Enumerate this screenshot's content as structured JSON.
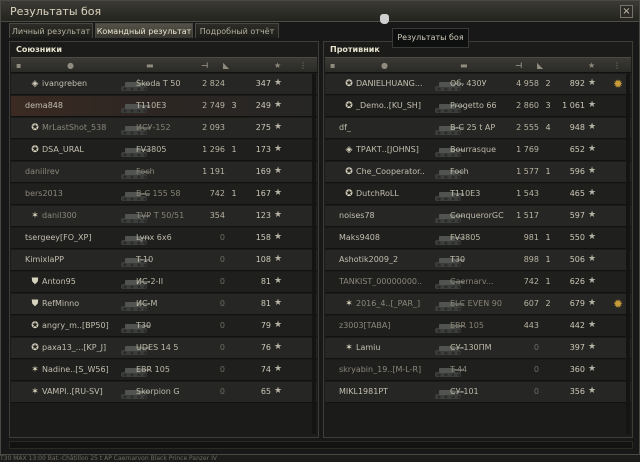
{
  "window": {
    "title": "Результаты боя",
    "close_label": "×"
  },
  "tabs": [
    {
      "label": "Личный результат",
      "active": false
    },
    {
      "label": "Командный результат",
      "active": true
    },
    {
      "label": "Подробный отчёт",
      "active": false
    }
  ],
  "tooltip": "Результаты боя",
  "allies": {
    "team_name": "Союзники",
    "rows": [
      {
        "clan_icon": "rank-icon",
        "player": "ivangreben",
        "tank": "Škoda T 50",
        "damage": "2 824",
        "kills": "",
        "xp": "347",
        "dead": false
      },
      {
        "clan_icon": "",
        "player": "dema848",
        "tank": "T110E3",
        "damage": "2 749",
        "kills": "3",
        "xp": "249",
        "dead": false,
        "self": true
      },
      {
        "clan_icon": "clan-emblem-icon",
        "player": "MrLastShot_538",
        "tank": "ИСУ-152",
        "damage": "2 093",
        "kills": "",
        "xp": "275",
        "dead": true
      },
      {
        "clan_icon": "clan-emblem-icon",
        "player": "DSA_URAL",
        "tank": "FV3805",
        "damage": "1 296",
        "kills": "1",
        "xp": "173",
        "dead": false
      },
      {
        "clan_icon": "",
        "player": "daniilrev",
        "tank": "Foch",
        "damage": "1 191",
        "kills": "",
        "xp": "169",
        "dead": true
      },
      {
        "clan_icon": "",
        "player": "bers2013",
        "tank": "B-C 155 58",
        "damage": "742",
        "kills": "1",
        "xp": "167",
        "dead": true
      },
      {
        "clan_icon": "star-badge-icon",
        "player": "danil300",
        "tank": "TVP T 50/51",
        "damage": "354",
        "kills": "",
        "xp": "123",
        "dead": true
      },
      {
        "clan_icon": "",
        "player": "tsergeey[FO_XP]",
        "tank": "Lynx 6x6",
        "damage": "0",
        "kills": "",
        "xp": "158",
        "dead": false
      },
      {
        "clan_icon": "",
        "player": "KimixlaPP",
        "tank": "T-10",
        "damage": "0",
        "kills": "",
        "xp": "108",
        "dead": false
      },
      {
        "clan_icon": "shield-rank-icon",
        "player": "Anton95",
        "tank": "ИС-2-II",
        "damage": "0",
        "kills": "",
        "xp": "81",
        "dead": false
      },
      {
        "clan_icon": "shield-rank-icon",
        "player": "RefMinno",
        "tank": "ИС-М",
        "damage": "0",
        "kills": "",
        "xp": "81",
        "dead": false
      },
      {
        "clan_icon": "clan-emblem-icon",
        "player": "angry_m..[BP50]",
        "tank": "T30",
        "damage": "0",
        "kills": "",
        "xp": "79",
        "dead": false
      },
      {
        "clan_icon": "clan-emblem-icon",
        "player": "paxa13_...[KP_J]",
        "tank": "UDES 14 5",
        "damage": "0",
        "kills": "",
        "xp": "76",
        "dead": false
      },
      {
        "clan_icon": "star-badge-icon",
        "player": "Nadine..[S_W56]",
        "tank": "EBR 105",
        "damage": "0",
        "kills": "",
        "xp": "74",
        "dead": false
      },
      {
        "clan_icon": "star-badge-icon",
        "player": "VAMPI..[RU-SV]",
        "tank": "Skorpion G",
        "damage": "0",
        "kills": "",
        "xp": "65",
        "dead": false
      }
    ]
  },
  "enemies": {
    "team_name": "Противник",
    "rows": [
      {
        "clan_icon": "clan-emblem-icon",
        "player": "DANIELHUANG...",
        "tank": "Об. 430У",
        "damage": "4 958",
        "kills": "2",
        "xp": "892",
        "dead": false,
        "medal": true
      },
      {
        "clan_icon": "clan-emblem-icon",
        "player": "_Demo..[KU_SH]",
        "tank": "Progetto 66",
        "damage": "2 860",
        "kills": "3",
        "xp": "1 061",
        "dead": false
      },
      {
        "clan_icon": "",
        "player": "df_",
        "tank": "B-C 25 t AP",
        "damage": "2 555",
        "kills": "4",
        "xp": "948",
        "dead": false
      },
      {
        "clan_icon": "rank-icon",
        "player": "ТРАКТ..[JOHNS]",
        "tank": "Bourrasque",
        "damage": "1 769",
        "kills": "",
        "xp": "652",
        "dead": false
      },
      {
        "clan_icon": "clan-emblem-icon",
        "player": "Che_Cooperator..",
        "tank": "Foch",
        "damage": "1 577",
        "kills": "1",
        "xp": "596",
        "dead": false
      },
      {
        "clan_icon": "clan-emblem-icon",
        "player": "DutchRoLL",
        "tank": "T110E3",
        "damage": "1 543",
        "kills": "",
        "xp": "465",
        "dead": false
      },
      {
        "clan_icon": "",
        "player": "noises78",
        "tank": "ConquerorGC",
        "damage": "1 517",
        "kills": "",
        "xp": "597",
        "dead": false
      },
      {
        "clan_icon": "",
        "player": "Maks9408",
        "tank": "FV3805",
        "damage": "981",
        "kills": "1",
        "xp": "550",
        "dead": false
      },
      {
        "clan_icon": "",
        "player": "Ashotik2009_2",
        "tank": "T30",
        "damage": "898",
        "kills": "1",
        "xp": "506",
        "dead": false
      },
      {
        "clan_icon": "",
        "player": "TANKIST_00000000..",
        "tank": "Caernarv...",
        "damage": "742",
        "kills": "1",
        "xp": "626",
        "dead": true
      },
      {
        "clan_icon": "star-badge-icon",
        "player": "2016_4..[_PAR_]",
        "tank": "ELC EVEN 90",
        "damage": "607",
        "kills": "2",
        "xp": "679",
        "dead": true,
        "medal": true
      },
      {
        "clan_icon": "",
        "player": "z3003[TABA]",
        "tank": "EBR 105",
        "damage": "443",
        "kills": "",
        "xp": "442",
        "dead": true
      },
      {
        "clan_icon": "star-badge-icon",
        "player": "Lamiu",
        "tank": "СУ-130ПМ",
        "damage": "0",
        "kills": "",
        "xp": "397",
        "dead": false
      },
      {
        "clan_icon": "",
        "player": "skryabin_19..[M-L-R]",
        "tank": "T-44",
        "damage": "0",
        "kills": "",
        "xp": "360",
        "dead": true
      },
      {
        "clan_icon": "",
        "player": "MIKL1981PT",
        "tank": "СУ-101",
        "damage": "0",
        "kills": "",
        "xp": "356",
        "dead": false
      }
    ]
  },
  "footer_text": "T30          MAX 13:00          Bat.-Châtillon 25 t AP          Caernarvon          Black Prince          Panzer IV"
}
